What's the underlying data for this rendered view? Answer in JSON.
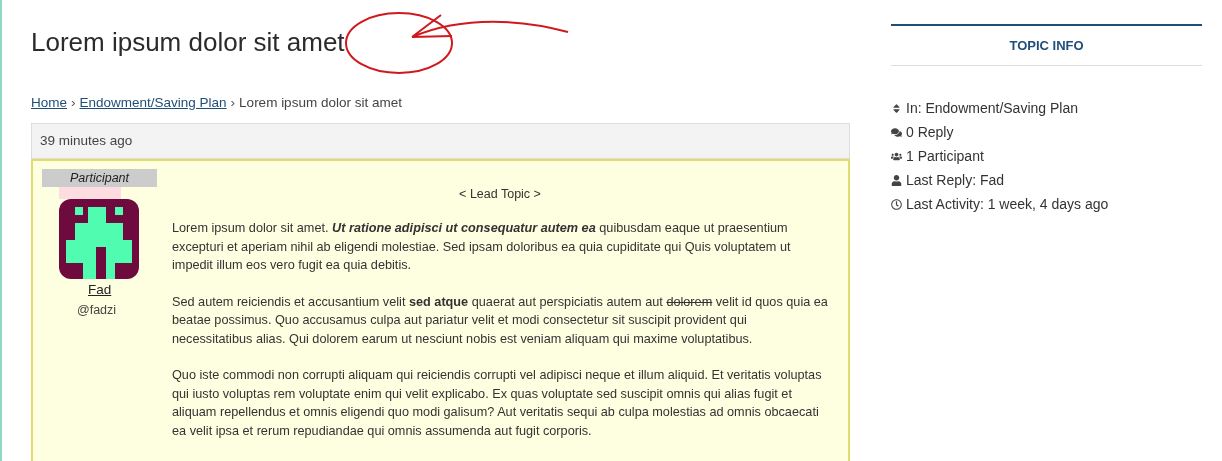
{
  "title": "Lorem ipsum dolor sit amet",
  "breadcrumb": [
    {
      "label": "Home",
      "kind": "link"
    },
    {
      "label": "›",
      "kind": "separator"
    },
    {
      "label": "Endowment/Saving Plan",
      "kind": "link"
    },
    {
      "label": "›",
      "kind": "separator"
    },
    {
      "label": "Lorem ipsum dolor sit amet",
      "kind": "current"
    }
  ],
  "post": {
    "time": "39 minutes ago",
    "role": "Participant",
    "author": {
      "name": "Fad",
      "handle": "@fadzi"
    },
    "lead_label": "< Lead Topic >",
    "paragraphs": [
      [
        {
          "text": "Lorem ipsum dolor sit amet. ",
          "kind": "plain"
        },
        {
          "text": "Ut ratione adipisci ut consequatur autem ea",
          "kind": "emphasis"
        },
        {
          "text": " quibusdam eaque ut praesentium excepturi et aperiam nihil ab eligendi molestiae. Sed ipsam doloribus ea quia cupiditate qui Quis voluptatem ut impedit illum eos vero fugit ea quia debitis.",
          "kind": "plain"
        }
      ],
      [
        {
          "text": "Sed autem reiciendis et accusantium velit ",
          "kind": "plain"
        },
        {
          "text": "sed atque",
          "kind": "strong"
        },
        {
          "text": " quaerat aut perspiciatis autem aut ",
          "kind": "plain"
        },
        {
          "text": "dolorem",
          "kind": "deleted"
        },
        {
          "text": " velit id quos quia ea beatae possimus. Quo accusamus culpa aut pariatur velit et modi consectetur sit suscipit provident qui necessitatibus alias. Qui dolorem earum ut nesciunt nobis est veniam aliquam qui maxime voluptatibus.",
          "kind": "plain"
        }
      ],
      [
        {
          "text": "Quo iste commodi non corrupti aliquam qui reiciendis corrupti vel adipisci neque et illum aliquid. Et veritatis voluptas qui iusto voluptas rem voluptate enim qui velit explicabo. Ex quas voluptate sed suscipit omnis qui alias fugit et aliquam repellendus et omnis eligendi quo modi galisum? Aut veritatis sequi ab culpa molestias ad omnis obcaecati ea velit ipsa et rerum repudiandae qui omnis assumenda aut fugit corporis.",
          "kind": "plain"
        }
      ]
    ]
  },
  "sidebar": {
    "heading": "TOPIC INFO",
    "items": [
      {
        "kind": "forum",
        "text": "In: Endowment/Saving Plan"
      },
      {
        "kind": "replies",
        "text": "0 Reply"
      },
      {
        "kind": "participants",
        "text": "1 Participant"
      },
      {
        "kind": "last_reply",
        "text": "Last Reply: Fad"
      },
      {
        "kind": "activity",
        "text": "Last Activity: 1 week, 4 days ago"
      }
    ]
  }
}
